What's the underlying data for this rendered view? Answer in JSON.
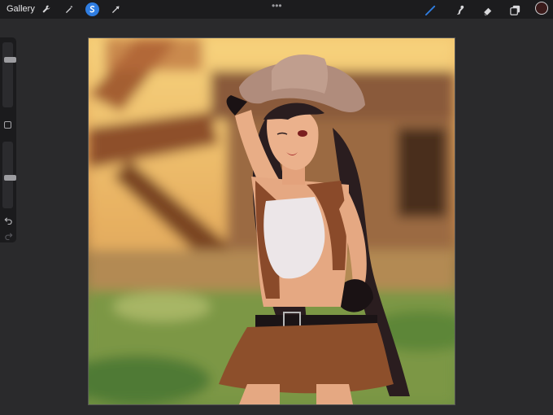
{
  "toolbar": {
    "gallery_label": "Gallery",
    "more_label": "•••",
    "left_tools": [
      "wrench-icon",
      "magic-wand-icon",
      "selection-icon",
      "transform-arrow-icon"
    ],
    "active_tool": "selection-icon",
    "right_tools": [
      "brush-icon",
      "smudge-icon",
      "eraser-icon",
      "layers-icon"
    ],
    "active_right_tool": "brush-icon",
    "current_color": "#3a1a1a",
    "accent_color": "#2f7de1"
  },
  "sidebar": {
    "brush_size_level": 0.25,
    "opacity_level": 0.55,
    "modify_icon": "square-icon",
    "undo_icon": "undo-icon",
    "redo_icon": "redo-icon"
  },
  "canvas": {
    "content": "illustration"
  }
}
